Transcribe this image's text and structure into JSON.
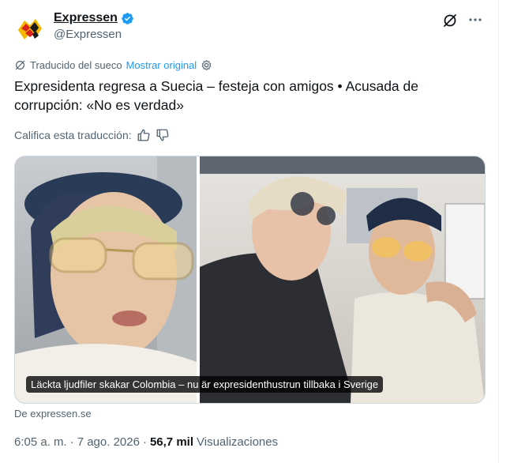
{
  "author": {
    "display_name": "Expressen",
    "handle": "@Expressen",
    "verified": true,
    "avatar_icon": "expressen-logo"
  },
  "header_actions": {
    "grok_icon": "grok-icon",
    "more_icon": "more-dots-icon"
  },
  "translation": {
    "note": "Traducido del sueco",
    "show_original": "Mostrar original",
    "settings_icon": "gear-icon",
    "rate_label": "Califica esta traducción:",
    "thumbs_up_icon": "thumbs-up-icon",
    "thumbs_down_icon": "thumbs-down-icon"
  },
  "post": {
    "text": "Expresidenta regresa a Suecia – festeja con amigos • Acusada de corrupción: «No es verdad»"
  },
  "media": {
    "caption": "Läckta ljudfiler skakar Colombia – nu är expresidenthustrun tillbaka i Sverige",
    "source": "De expressen.se"
  },
  "meta": {
    "time": "6:05 a. m.",
    "separator": "·",
    "date": "7 ago. 2026",
    "views_count": "56,7 mil",
    "views_label": "Visualizaciones"
  },
  "colors": {
    "accent": "#1d9bf0",
    "text_primary": "#0f1419",
    "text_secondary": "#536471",
    "border": "#cfd9de"
  }
}
